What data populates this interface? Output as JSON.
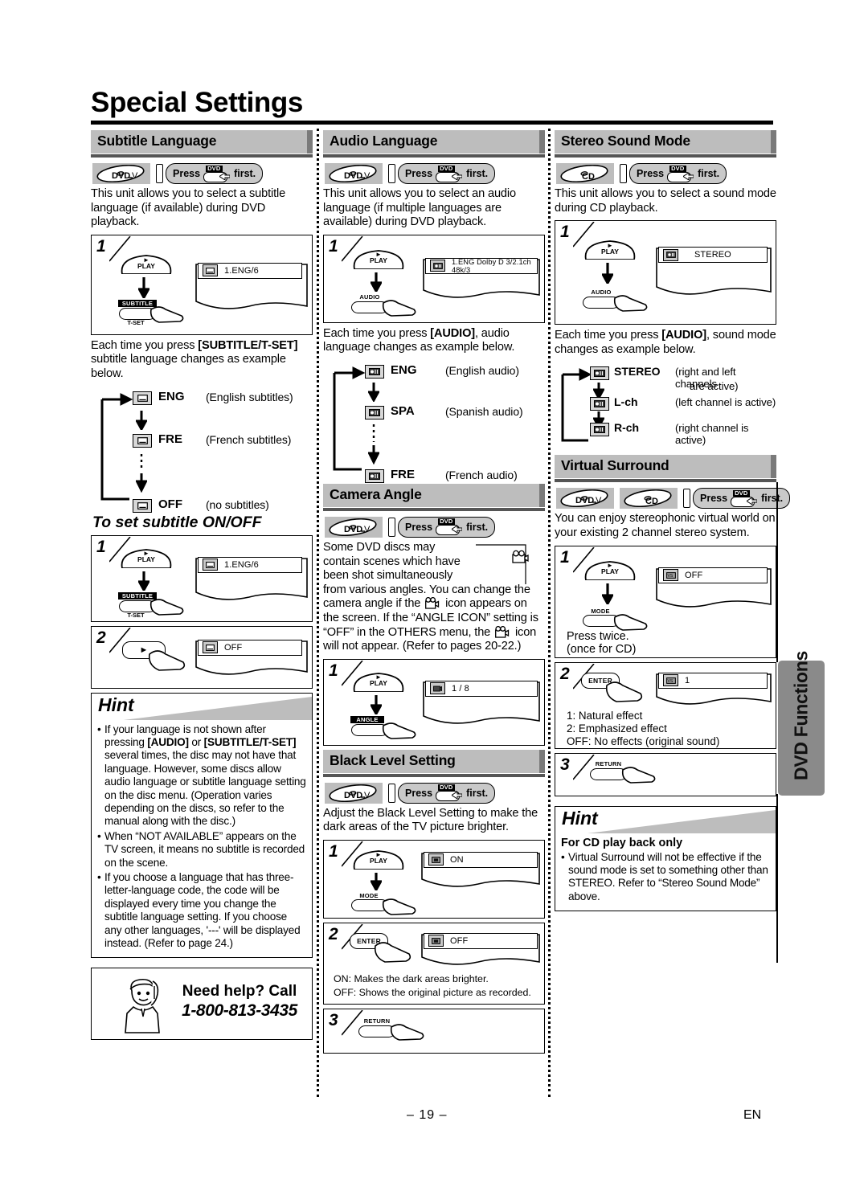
{
  "page": {
    "title": "Special Settings",
    "page_number": "– 19 –",
    "language_mark": "EN",
    "side_tab": "DVD Functions"
  },
  "press_first": {
    "pre": "Press",
    "post": "first.",
    "key": "DVD"
  },
  "subtitle_language": {
    "heading": "Subtitle Language",
    "badges": [
      "DVD-V"
    ],
    "intro": "This unit allows you to select a subtitle language (if available) during DVD playback.",
    "step1": {
      "num": "1",
      "key_top": "PLAY",
      "key_bottom_above": "SUBTITLE",
      "key_bottom_below": "T-SET",
      "osd": "1.ENG/6"
    },
    "cycle_intro_pre": "Each time you press ",
    "cycle_intro_key": "[SUBTITLE/T-SET]",
    "cycle_intro_post": " subtitle language changes as example below.",
    "cycle": [
      {
        "code": "ENG",
        "desc": "(English subtitles)"
      },
      {
        "code": "FRE",
        "desc": "(French subtitles)"
      },
      {
        "code": "OFF",
        "desc": "(no subtitles)"
      }
    ],
    "onoff_heading": "To set subtitle ON/OFF",
    "onoff_step1": {
      "num": "1",
      "key_top": "PLAY",
      "key_bottom_above": "SUBTITLE",
      "key_bottom_below": "T-SET",
      "osd": "1.ENG/6"
    },
    "onoff_step2": {
      "num": "2",
      "osd": "OFF"
    }
  },
  "hint_left": {
    "heading": "Hint",
    "bullets": [
      "If your language is not shown after pressing [AUDIO] or [SUBTITLE/T-SET] several times, the disc may not have that language. However, some discs allow audio language or subtitle language setting on the disc menu. (Operation varies depending on the discs, so refer to the manual along with the disc.)",
      "When “NOT AVAILABLE” appears on the TV screen, it means no subtitle is recorded on the scene.",
      "If you choose a language that has three-letter-language code, the code will be displayed every time you change the subtitle language setting. If you choose any other languages, '---' will be displayed instead. (Refer to page 24.)"
    ]
  },
  "need_help": {
    "line1": "Need help? Call",
    "line2": "1-800-813-3435"
  },
  "audio_language": {
    "heading": "Audio Language",
    "badges": [
      "DVD-V"
    ],
    "intro": "This unit allows you to select an audio language (if multiple languages are available) during DVD playback.",
    "step1": {
      "num": "1",
      "key_top": "PLAY",
      "key_bottom_above": "AUDIO",
      "osd": "1.ENG  Dolby D  3/2.1ch  48k/3"
    },
    "cycle_intro_pre": "Each time you press ",
    "cycle_intro_key": "[AUDIO]",
    "cycle_intro_post": ", audio language changes as example below.",
    "cycle": [
      {
        "code": "ENG",
        "desc": "(English audio)"
      },
      {
        "code": "SPA",
        "desc": "(Spanish audio)"
      },
      {
        "code": "FRE",
        "desc": "(French audio)"
      }
    ]
  },
  "camera_angle": {
    "heading": "Camera Angle",
    "badges": [
      "DVD-V"
    ],
    "intro_a": "Some DVD discs may contain scenes which have been shot simultaneously",
    "intro_b": "from various angles. You can change the camera angle if the ",
    "intro_c": " icon appears on the screen. If the “ANGLE ICON” setting is “OFF” in the OTHERS menu, the ",
    "intro_d": " icon will not appear. (Refer to pages 20-22.)",
    "step1": {
      "num": "1",
      "key_top": "PLAY",
      "key_bottom_above": "ANGLE",
      "osd": "1 / 8"
    }
  },
  "black_level": {
    "heading": "Black Level Setting",
    "badges": [
      "DVD-V"
    ],
    "intro": "Adjust the Black Level Setting to make the dark areas of the TV picture brighter.",
    "step1": {
      "num": "1",
      "key_top": "PLAY",
      "key_bottom_above": "MODE",
      "osd": "ON"
    },
    "step2": {
      "num": "2",
      "key": "ENTER",
      "osd": "OFF",
      "note1": "ON: Makes the dark areas brighter.",
      "note2": "OFF: Shows the original picture as recorded."
    },
    "step3": {
      "num": "3",
      "key_above": "RETURN"
    }
  },
  "stereo_sound_mode": {
    "heading": "Stereo Sound Mode",
    "badges": [
      "CD"
    ],
    "intro": "This unit allows you to select a sound mode during CD playback.",
    "step1": {
      "num": "1",
      "key_top": "PLAY",
      "key_bottom_above": "AUDIO",
      "osd": "STEREO"
    },
    "cycle_intro_pre": "Each time you press ",
    "cycle_intro_key": "[AUDIO]",
    "cycle_intro_post": ", sound mode changes as example below.",
    "cycle": [
      {
        "code": "STEREO",
        "desc": "(right and left channels",
        "desc2": "are active)"
      },
      {
        "code": "L-ch",
        "desc": "(left channel is active)"
      },
      {
        "code": "R-ch",
        "desc": "(right channel is active)"
      }
    ]
  },
  "virtual_surround": {
    "heading": "Virtual Surround",
    "badges": [
      "DVD-V",
      "CD"
    ],
    "intro": "You can enjoy stereophonic virtual world on your existing 2 channel stereo system.",
    "step1": {
      "num": "1",
      "key_top": "PLAY",
      "key_bottom_above": "MODE",
      "osd": "OFF",
      "note1": "Press twice.",
      "note2": "(once for CD)"
    },
    "step2": {
      "num": "2",
      "key": "ENTER",
      "osd": "1",
      "note1": "1: Natural effect",
      "note2": "2: Emphasized effect",
      "note3": "OFF: No effects (original sound)"
    },
    "step3": {
      "num": "3",
      "key_above": "RETURN"
    }
  },
  "hint_right": {
    "heading": "Hint",
    "subheading": "For CD play back only",
    "bullets": [
      "Virtual Surround will not be effective if the sound mode is set to something other than STEREO. Refer to “Stereo Sound Mode” above."
    ]
  }
}
